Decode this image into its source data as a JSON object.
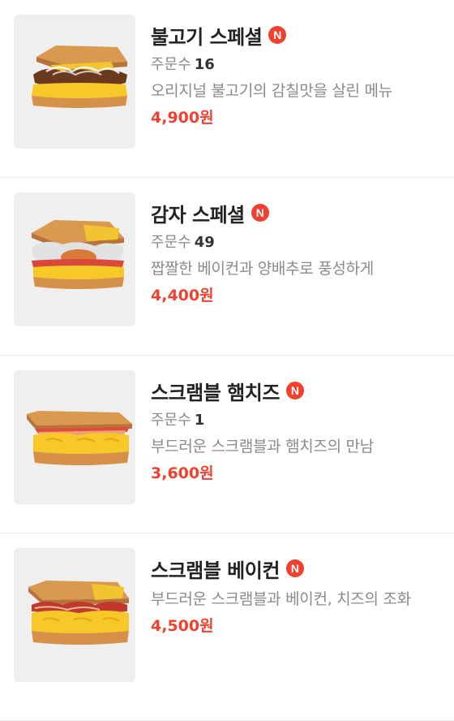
{
  "colors": {
    "accent": "#f2402f",
    "title": "#222222",
    "muted": "#8a8a8a",
    "thumb_bg": "#efefef"
  },
  "orders_label": "주문수",
  "items": [
    {
      "name": "불고기 스페셜",
      "badge": "N",
      "orders": "16",
      "description": "오리지널 불고기의 감칠맛을 살린 메뉴",
      "price": "4,900원",
      "image_icon": "bulgogi-sandwich-image"
    },
    {
      "name": "감자 스페셜",
      "badge": "N",
      "orders": "49",
      "description": "짭짤한 베이컨과 양배추로 풍성하게",
      "price": "4,400원",
      "image_icon": "potato-sandwich-image"
    },
    {
      "name": "스크램블 햄치즈",
      "badge": "N",
      "orders": "1",
      "description": "부드러운 스크램블과 햄치즈의 만남",
      "price": "3,600원",
      "image_icon": "ham-cheese-sandwich-image"
    },
    {
      "name": "스크램블 베이컨",
      "badge": "N",
      "description": "부드러운 스크램블과 베이컨, 치즈의 조화",
      "price": "4,500원",
      "image_icon": "bacon-sandwich-image"
    }
  ]
}
